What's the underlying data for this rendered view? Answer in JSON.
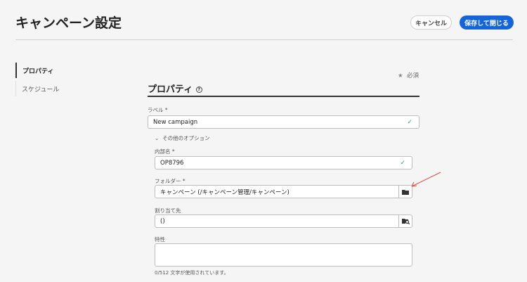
{
  "header": {
    "title": "キャンペーン設定",
    "cancel_label": "キャンセル",
    "save_label": "保存して閉じる"
  },
  "sidebar": {
    "items": [
      {
        "label": "プロパティ",
        "active": true
      },
      {
        "label": "スケジュール",
        "active": false
      }
    ]
  },
  "form": {
    "required_note": "必須",
    "section_title": "プロパティ",
    "label": {
      "label": "ラベル",
      "value": "New campaign"
    },
    "more_options": "その他のオプション",
    "internal_name": {
      "label": "内部名",
      "value": "OP8796"
    },
    "folder": {
      "label": "フォルダー",
      "value": "キャンペーン (/キャンペーン管理/キャンペーン)"
    },
    "assignee": {
      "label": "割り当て先",
      "value": "()"
    },
    "description": {
      "label": "特性",
      "value": "",
      "counter": "0/512 文字が使用されています。"
    }
  },
  "colors": {
    "accent": "#1565d8",
    "check": "#2d9d78",
    "annotation": "#e0483e"
  }
}
